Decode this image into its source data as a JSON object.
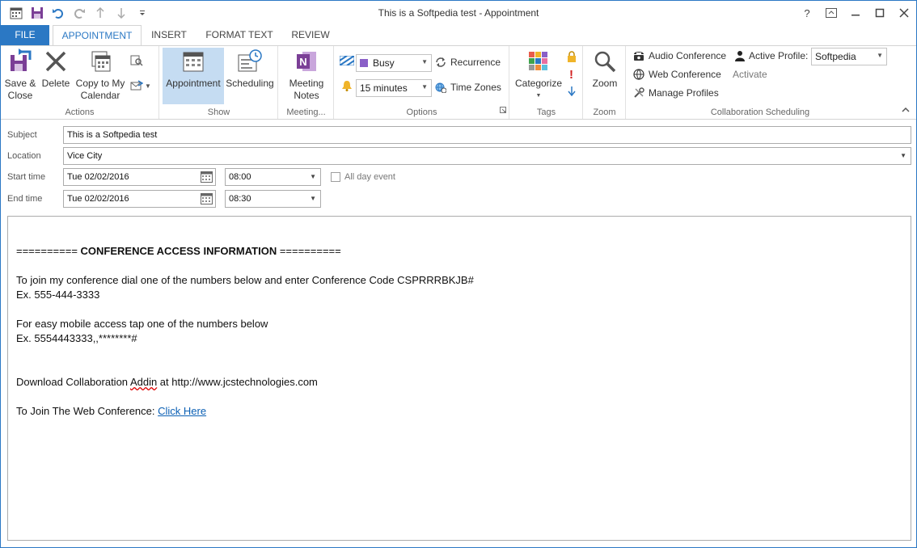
{
  "window": {
    "title": "This is a Softpedia test - Appointment"
  },
  "tabs": [
    "FILE",
    "APPOINTMENT",
    "INSERT",
    "FORMAT TEXT",
    "REVIEW"
  ],
  "ribbon": {
    "actions": {
      "label": "Actions",
      "save_close": "Save &\nClose",
      "save_close_l1": "Save &",
      "save_close_l2": "Close",
      "delete": "Delete",
      "copy_l1": "Copy to My",
      "copy_l2": "Calendar"
    },
    "show": {
      "label": "Show",
      "appointment": "Appointment",
      "scheduling": "Scheduling"
    },
    "meeting": {
      "label": "Meeting...",
      "notes_l1": "Meeting",
      "notes_l2": "Notes"
    },
    "options": {
      "label": "Options",
      "show_as": "Busy",
      "reminder": "15 minutes",
      "recurrence": "Recurrence",
      "time_zones": "Time Zones"
    },
    "tags": {
      "label": "Tags",
      "categorize": "Categorize"
    },
    "zoom": {
      "label": "Zoom",
      "zoom": "Zoom"
    },
    "collab": {
      "label": "Collaboration Scheduling",
      "audio": "Audio Conference",
      "web": "Web Conference",
      "manage": "Manage Profiles",
      "active_profile_label": "Active Profile:",
      "active_profile_value": "Softpedia",
      "activate": "Activate"
    }
  },
  "form": {
    "subject_label": "Subject",
    "subject_value": "This is a Softpedia test",
    "location_label": "Location",
    "location_value": "Vice City",
    "start_label": "Start time",
    "start_date": "Tue 02/02/2016",
    "start_time": "08:00",
    "end_label": "End time",
    "end_date": "Tue 02/02/2016",
    "end_time": "08:30",
    "all_day_label": "All day event"
  },
  "body": {
    "heading_prefix": "========== ",
    "heading": "CONFERENCE ACCESS INFORMATION",
    "heading_suffix": " ==========",
    "line1": "To join my conference dial one of the numbers below and enter Conference Code CSPRRRBKJB#",
    "line2": "Ex. 555-444-3333",
    "line3": "For easy mobile access tap one of the numbers below",
    "line4": "Ex. 5554443333,,********#",
    "download_pre": "Download Collaboration ",
    "download_addin": "Addin",
    "download_post": " at http://www.jcstechnologies.com",
    "join_pre": "To Join The Web Conference: ",
    "join_link": "Click Here"
  },
  "colors": {
    "accent": "#2b78c4",
    "selected": "#c5dcf2",
    "link": "#0a5fb4"
  }
}
